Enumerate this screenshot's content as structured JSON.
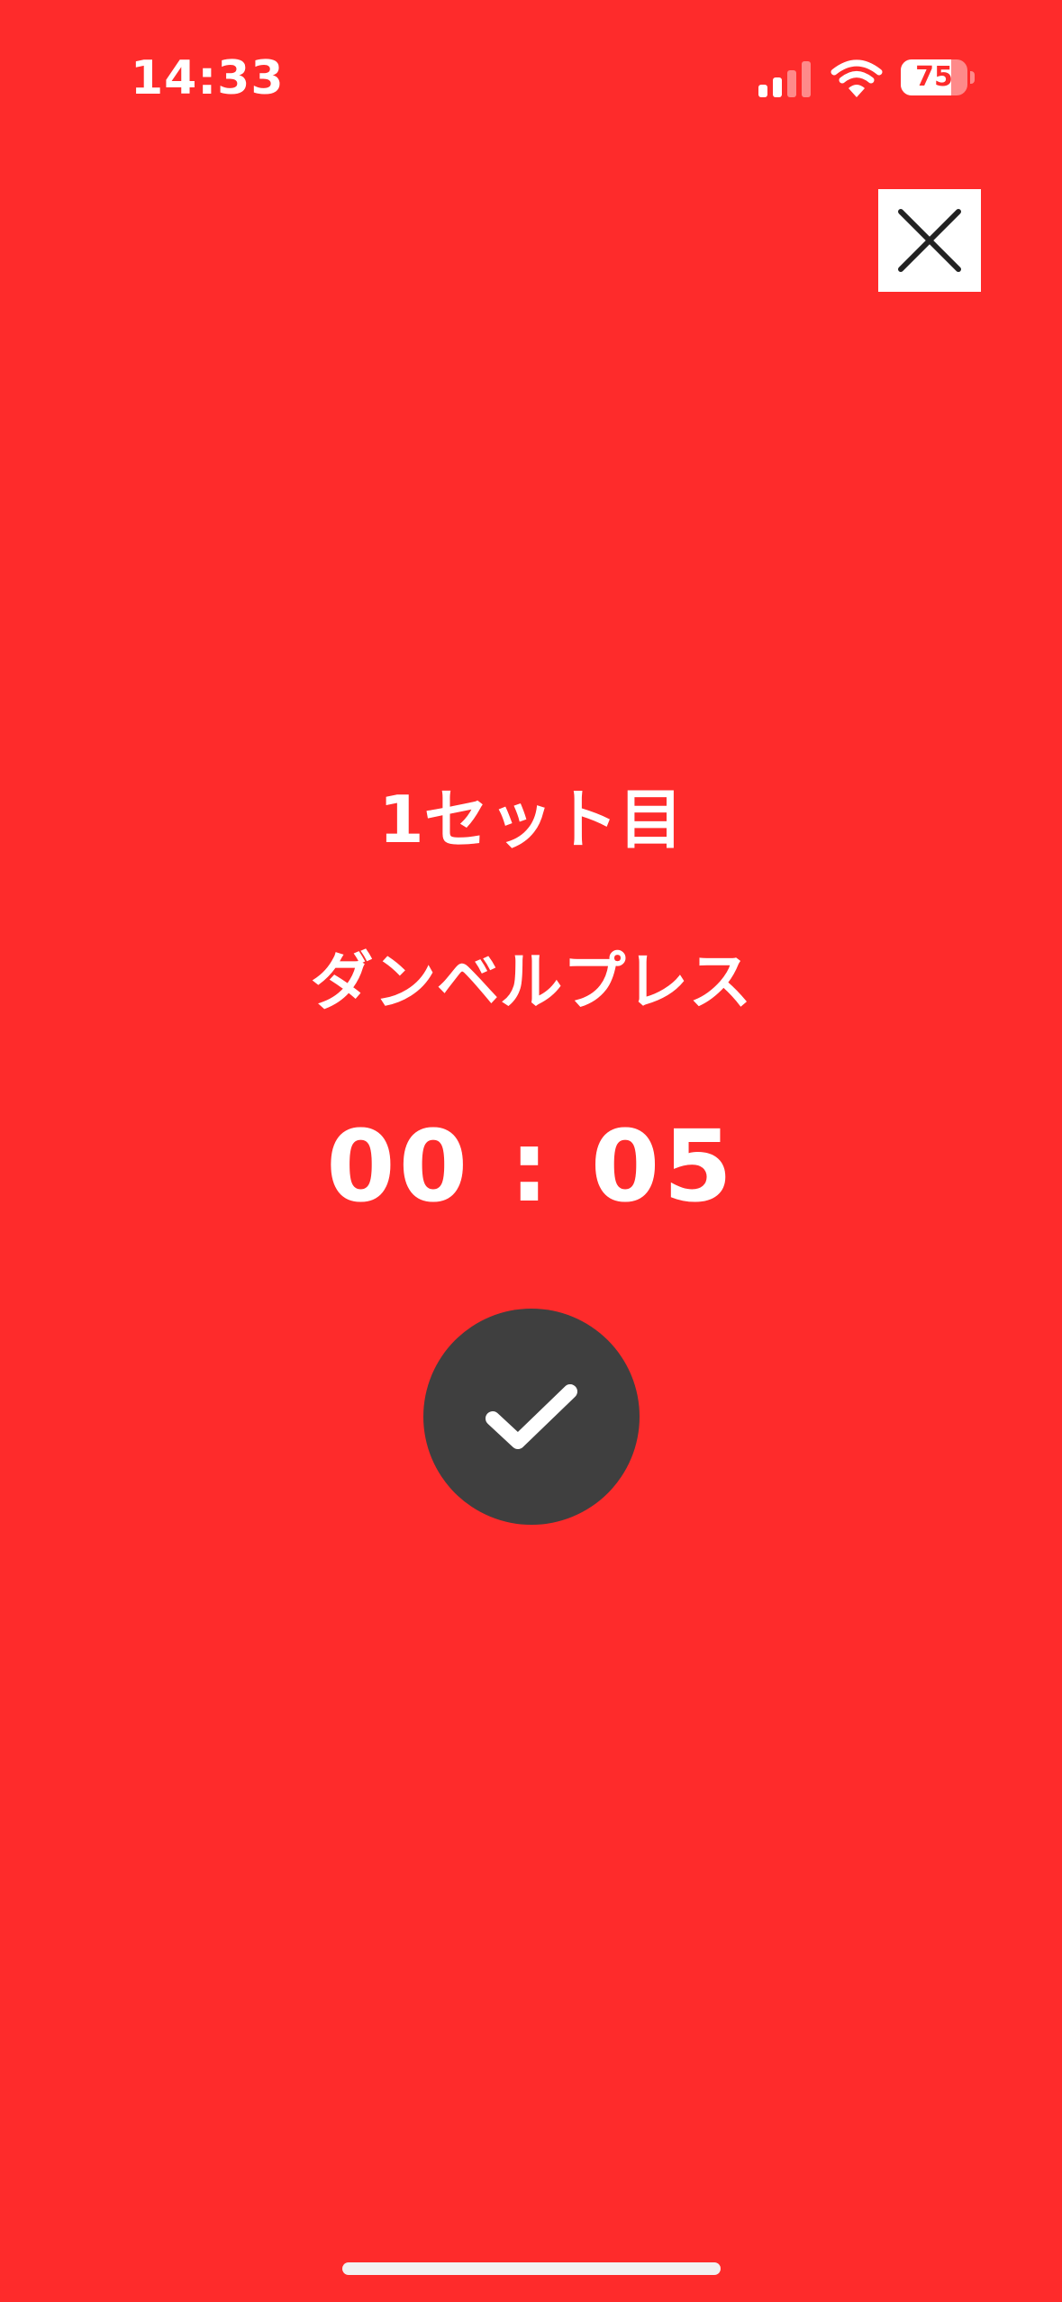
{
  "status_bar": {
    "time": "14:33",
    "battery_level": "75",
    "battery_fraction": 0.75,
    "icons": [
      "signal-icon",
      "wifi-icon",
      "battery-icon"
    ]
  },
  "workout": {
    "set_label": "1セット目",
    "exercise_name": "ダンベルプレス",
    "timer": "00 : 05"
  },
  "buttons": {
    "close_icon": "close-icon",
    "complete_icon": "checkmark-icon"
  },
  "colors": {
    "background": "#FE2B2B",
    "complete_button": "#3F3F3F",
    "close_button": "#FFFFFF",
    "text": "#FFFFFF"
  }
}
